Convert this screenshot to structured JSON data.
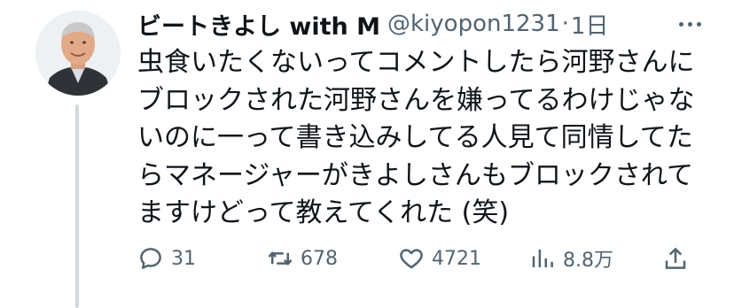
{
  "tweet": {
    "display_name": "ビートきよし with M",
    "handle": "@kiyopon1231",
    "separator": "·",
    "time": "1日",
    "text_lines": [
      "虫食いたくないってコメントしたら河野さんに",
      "ブロックされた河野さんを嫌ってるわけじゃな",
      "いのに一って書き込みしてる人見て同情してた",
      "らマネージャーがきよしさんもブロックされて",
      "ますけどって教えてくれた (笑)"
    ]
  },
  "actions": {
    "reply_count": "31",
    "retweet_count": "678",
    "like_count": "4721",
    "views_count": "8.8万"
  },
  "icons": {
    "more": "more-dots-icon",
    "reply": "reply-bubble-icon",
    "retweet": "retweet-icon",
    "like": "heart-icon",
    "views": "views-bar-chart-icon",
    "share": "share-icon"
  },
  "colors": {
    "text_primary": "#0f1419",
    "text_secondary": "#536471",
    "thread_line": "#cfd9de"
  }
}
